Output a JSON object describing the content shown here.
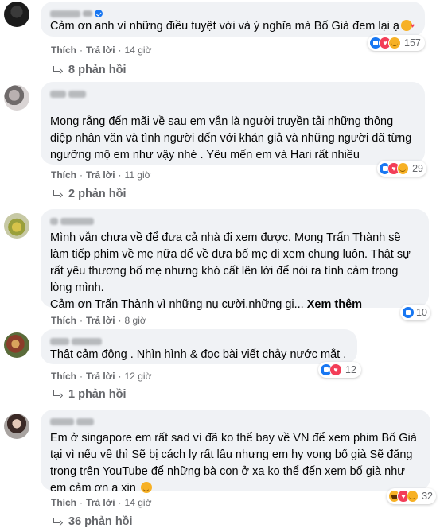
{
  "labels": {
    "like": "Thích",
    "reply": "Trả lời",
    "dot": "·"
  },
  "comments": [
    {
      "text": "Cảm ơn anh vì những điều tuyệt vời và ý nghĩa mà Bố Già đem lại ạ",
      "time": "14 giờ",
      "reaction_count": "157",
      "reactions": [
        "like-icon",
        "love-icon",
        "care-icon"
      ],
      "replies": "8 phản hồi"
    },
    {
      "text": "Mong rằng đến mãi về sau em vẫn là người truyền tải những thông điệp nhân văn và tình người đến với khán giả và những người đã từng ngưỡng mộ em như vậy nhé . Yêu mến em và Hari rất nhiều",
      "time": "11 giờ",
      "reaction_count": "29",
      "reactions": [
        "like-icon",
        "love-icon",
        "care-icon"
      ],
      "replies": "2 phản hồi"
    },
    {
      "text": "Mình vẫn chưa về để đưa cả nhà đi xem được. Mong Trấn Thành sẽ làm tiếp phim về mẹ nữa để về đưa bố mẹ đi xem chung luôn. Thật sự rất yêu thương bố mẹ nhưng khó cất lên lời để nói ra tình cảm trong lòng mình.",
      "text2": "Cảm ơn Trấn Thành vì những nụ cười,những gi...",
      "more": "Xem thêm",
      "time": "8 giờ",
      "reaction_count": "10",
      "reactions": [
        "like-icon"
      ]
    },
    {
      "text": "Thật cảm động . Nhìn hình & đọc bài viết chảy nước mắt .",
      "time": "12 giờ",
      "reaction_count": "12",
      "reactions": [
        "like-icon",
        "love-icon"
      ],
      "replies": "1 phản hồi"
    },
    {
      "text": "Em ở singapore em rất sad vì đã ko thể bay về VN để xem phim Bố Già tại vì nếu về thì Sẽ bị cách ly rất lâu nhưng em hy vong bố già Sẽ đăng trong trên YouTube để những bà con ở xa ko thể đến xem bố già như em cảm ơn a xin",
      "time": "14 giờ",
      "reaction_count": "32",
      "reactions": [
        "haha-icon",
        "love-icon",
        "care-icon"
      ],
      "replies": "36 phản hồi"
    }
  ]
}
